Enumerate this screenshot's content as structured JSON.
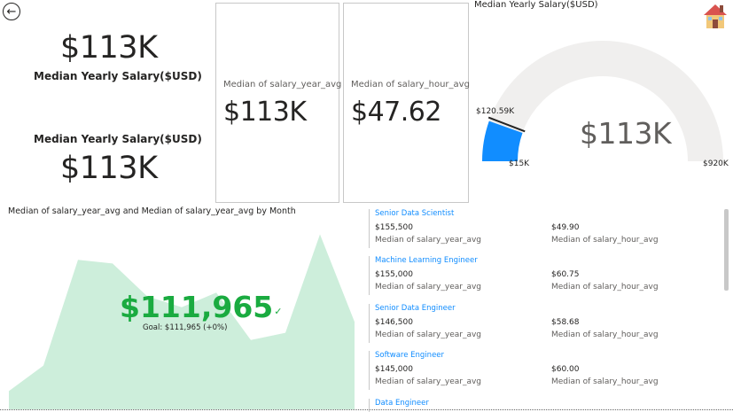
{
  "nav": {
    "back_icon": "back-arrow-icon",
    "home_icon": "home-icon"
  },
  "kpi_top": {
    "value": "$113K",
    "label": "Median Yearly Salary($USD)"
  },
  "kpi_bottom": {
    "value": "$113K",
    "label": "Median Yearly Salary($USD)"
  },
  "card_year": {
    "label": "Median of salary_year_avg",
    "value": "$113K"
  },
  "card_hour": {
    "label": "Median of salary_hour_avg",
    "value": "$47.62"
  },
  "gauge": {
    "title": "Median Yearly Salary($USD)",
    "value_label": "$113K",
    "min_label": "$15K",
    "max_label": "$920K",
    "target_label": "$120.59K",
    "min": 15000,
    "max": 920000,
    "value": 113000,
    "target": 120590,
    "fill_color": "#118dff",
    "track_color": "#f0efee"
  },
  "area_chart": {
    "title": "Median of salary_year_avg and Median of salary_year_avg by Month",
    "kpi_value": "$111,965",
    "kpi_check": "✓",
    "goal": "Goal: $111,965 (+0%)",
    "color": "#1aab40",
    "fill": "#cdeedb"
  },
  "chart_data": {
    "type": "area",
    "title": "Median of salary_year_avg and Median of salary_year_avg by Month",
    "x": [
      1,
      2,
      3,
      4,
      5,
      6,
      7,
      8,
      9,
      10,
      11
    ],
    "values": [
      93000,
      100000,
      129000,
      128000,
      119000,
      116000,
      120000,
      107000,
      109000,
      136000,
      112000
    ],
    "ylim": [
      88000,
      140000
    ]
  },
  "list": {
    "col1_label": "Median of salary_year_avg",
    "col2_label": "Median of salary_hour_avg",
    "items": [
      {
        "title": "Senior Data Scientist",
        "year": "$155,500",
        "hour": "$49.90"
      },
      {
        "title": "Machine Learning Engineer",
        "year": "$155,000",
        "hour": "$60.75"
      },
      {
        "title": "Senior Data Engineer",
        "year": "$146,500",
        "hour": "$58.68"
      },
      {
        "title": "Software Engineer",
        "year": "$145,000",
        "hour": "$60.00"
      },
      {
        "title": "Data Engineer"
      }
    ]
  }
}
